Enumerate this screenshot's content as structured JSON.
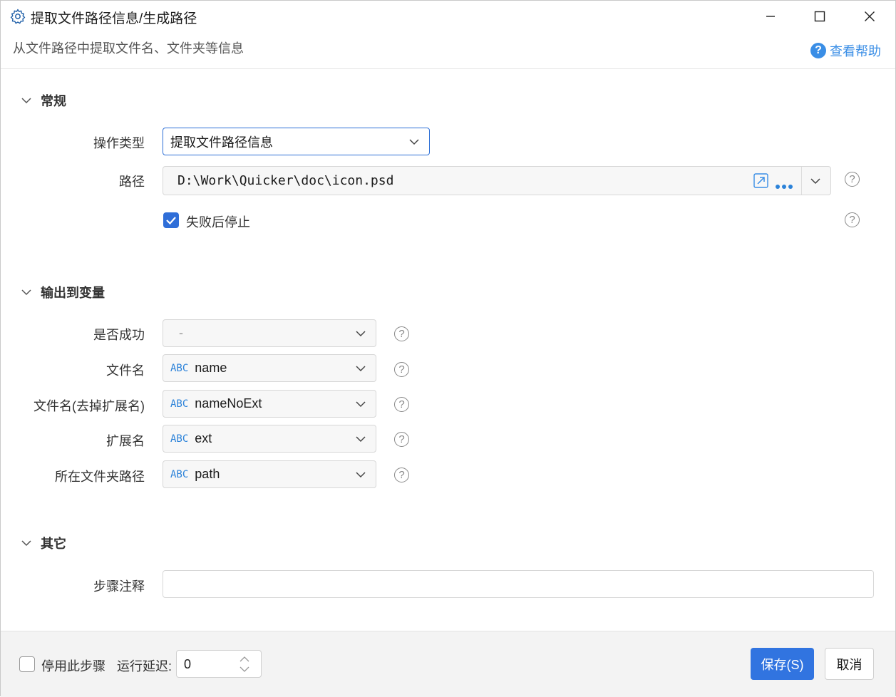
{
  "window": {
    "title": "提取文件路径信息/生成路径",
    "subtitle": "从文件路径中提取文件名、文件夹等信息",
    "help_label": "查看帮助"
  },
  "sections": {
    "general": {
      "title": "常规",
      "operation_label": "操作类型",
      "operation_value": "提取文件路径信息",
      "path_label": "路径",
      "path_value": "D:\\Work\\Quicker\\doc\\icon.psd",
      "stop_on_fail_label": "失败后停止",
      "stop_on_fail_checked": true
    },
    "output": {
      "title": "输出到变量",
      "success_label": "是否成功",
      "success_value": "-",
      "rows": [
        {
          "label": "文件名",
          "type": "ABC",
          "value": "name"
        },
        {
          "label": "文件名(去掉扩展名)",
          "type": "ABC",
          "value": "nameNoExt"
        },
        {
          "label": "扩展名",
          "type": "ABC",
          "value": "ext"
        },
        {
          "label": "所在文件夹路径",
          "type": "ABC",
          "value": "path"
        }
      ]
    },
    "other": {
      "title": "其它",
      "note_label": "步骤注释",
      "note_value": ""
    }
  },
  "footer": {
    "disable_label": "停用此步骤",
    "disable_checked": false,
    "delay_label": "运行延迟:",
    "delay_value": "0",
    "save_label": "保存(S)",
    "cancel_label": "取消"
  },
  "colors": {
    "accent": "#3174e0",
    "link": "#3a8ee6",
    "abc": "#2b82d9"
  }
}
